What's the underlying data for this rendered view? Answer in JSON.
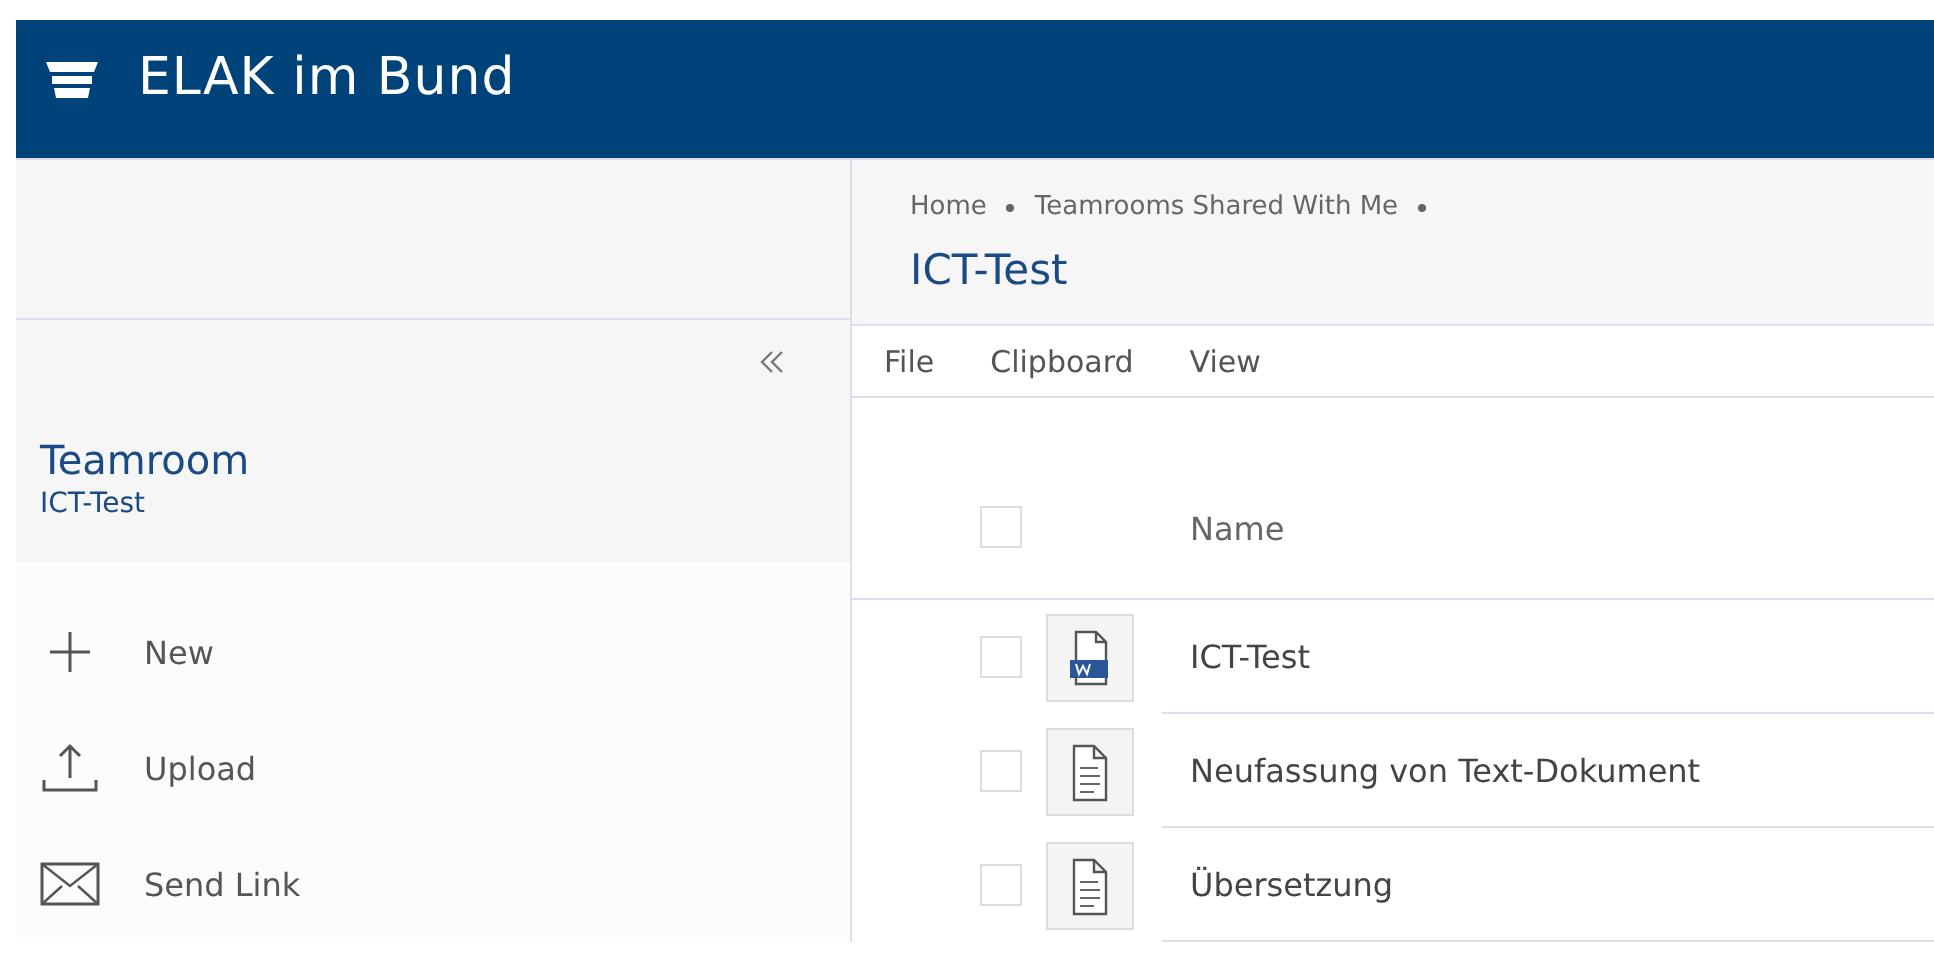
{
  "app_title": "ELAK im Bund",
  "breadcrumbs": [
    "Home",
    "Teamrooms Shared With Me"
  ],
  "page_title": "ICT-Test",
  "sidebar": {
    "heading": "Teamroom",
    "subheading": "ICT-Test",
    "actions": [
      {
        "label": "New",
        "kind": "new"
      },
      {
        "label": "Upload",
        "kind": "upload"
      },
      {
        "label": "Send Link",
        "kind": "mail"
      }
    ]
  },
  "menu": [
    "File",
    "Clipboard",
    "View"
  ],
  "table": {
    "select_all_checked": false,
    "columns": [
      "Name"
    ],
    "rows": [
      {
        "name": "ICT-Test",
        "kind": "word",
        "checked": false
      },
      {
        "name": "Neufassung von Text-Dokument",
        "kind": "text",
        "checked": false
      },
      {
        "name": "Übersetzung",
        "kind": "text",
        "checked": false
      }
    ]
  }
}
